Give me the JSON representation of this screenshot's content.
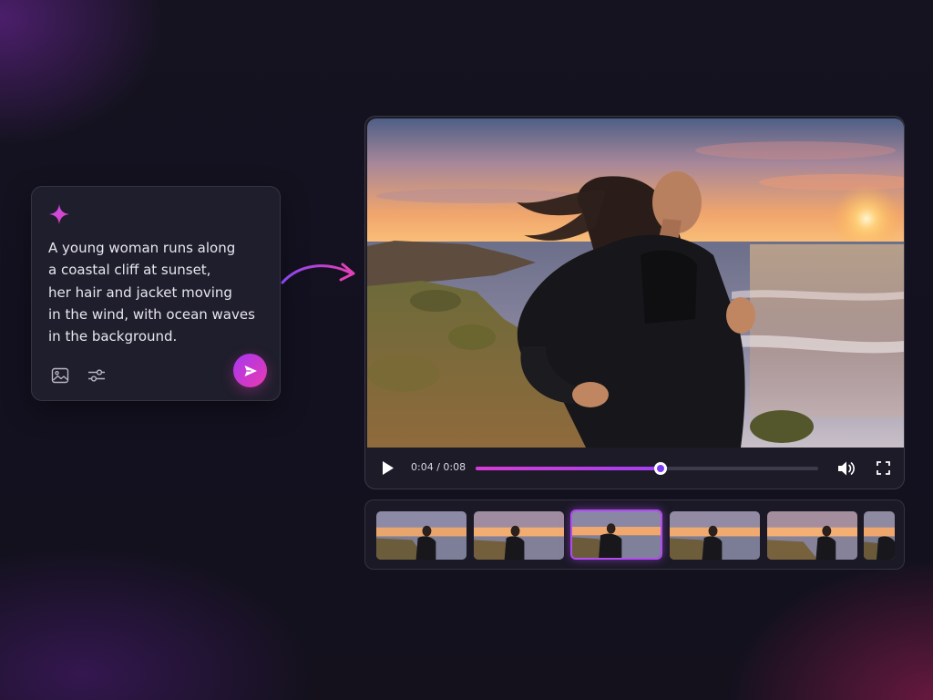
{
  "prompt": {
    "text_lines": [
      "A young woman runs along",
      "a coastal cliff at sunset,",
      "her hair and jacket moving",
      "in the wind, with ocean waves",
      "in the background."
    ],
    "icons": {
      "sparkle": "sparkle-icon",
      "image": "image-icon",
      "settings": "sliders-icon",
      "send": "send-icon"
    }
  },
  "player": {
    "time": "0:04 / 0:08",
    "current_seconds": 4,
    "duration_seconds": 8,
    "progress_fraction": 0.54,
    "icons": {
      "play": "play-icon",
      "volume": "volume-icon",
      "fullscreen": "fullscreen-icon"
    }
  },
  "filmstrip": {
    "thumbnail_count": 6,
    "selected_index": 2
  },
  "colors": {
    "accent_pink": "#e63cb8",
    "accent_purple": "#9b3cf0",
    "background": "#14121f",
    "panel": "#211f2e"
  }
}
